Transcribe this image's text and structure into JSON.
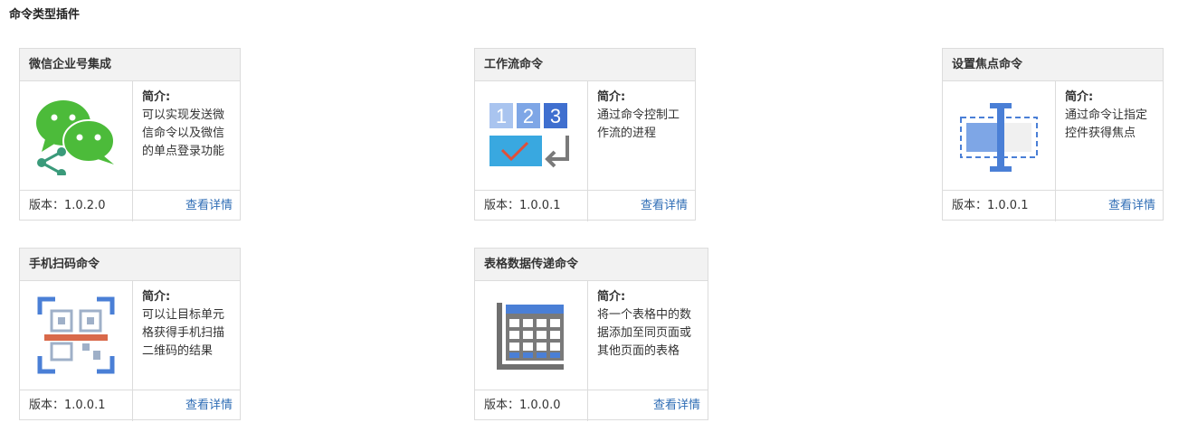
{
  "section_title": "命令类型插件",
  "description_label": "简介:",
  "details_label": "查看详情",
  "colors": {
    "link": "#2f6db5",
    "wechat_green": "#4cbb3a",
    "icon_blue": "#4a7fd6",
    "icon_gray": "#7a7a7a"
  },
  "plugins": [
    {
      "title": "微信企业号集成",
      "icon": "wechat-share-icon",
      "desc_lines": [
        "可以实现发送微",
        "信命令以及微信",
        "的单点登录功能"
      ],
      "version": "版本：1.0.2.0"
    },
    {
      "title": "工作流命令",
      "icon": "workflow-steps-icon",
      "desc_lines": [
        "通过命令控制工",
        "作流的进程"
      ],
      "version": "版本：1.0.0.1"
    },
    {
      "title": "设置焦点命令",
      "icon": "focus-cursor-icon",
      "desc_lines": [
        "通过命令让指定",
        "控件获得焦点"
      ],
      "version": "版本：1.0.0.1"
    },
    {
      "title": "手机扫码命令",
      "icon": "qr-scan-icon",
      "desc_lines": [
        "可以让目标单元",
        "格获得手机扫描",
        "二维码的结果"
      ],
      "version": "版本：1.0.0.1"
    },
    {
      "title": "表格数据传递命令",
      "icon": "table-grid-icon",
      "desc_lines": [
        "将一个表格中的数",
        "据添加至同页面或",
        "其他页面的表格"
      ],
      "version": "版本：1.0.0.0"
    }
  ]
}
